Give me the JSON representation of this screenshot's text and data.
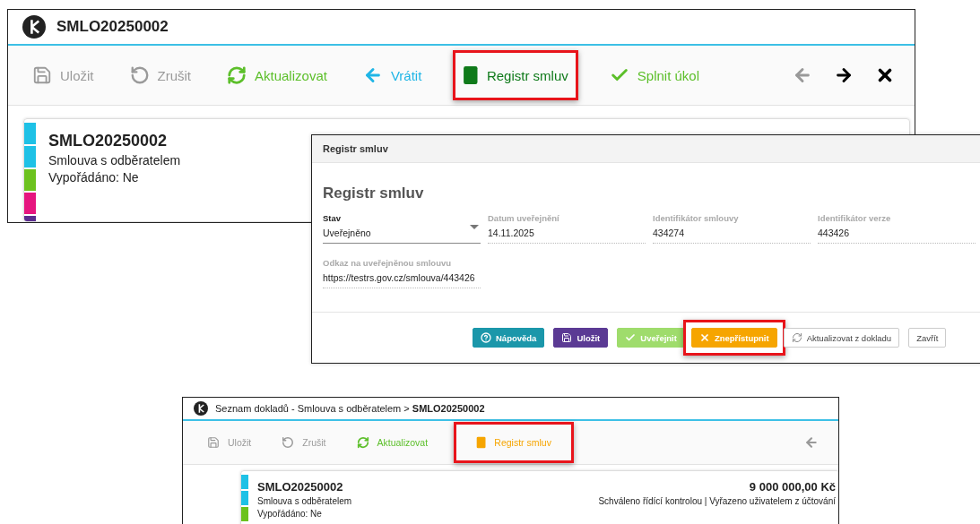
{
  "detail_window": {
    "title": "SMLO20250002",
    "toolbar": [
      {
        "kind": "save",
        "label": "Uložit",
        "color": "#9a9a9a",
        "highlighted": false
      },
      {
        "kind": "cancel",
        "label": "Zrušit",
        "color": "#9a9a9a",
        "highlighted": false
      },
      {
        "kind": "refresh",
        "label": "Aktualizovat",
        "color": "#5cbf2a",
        "highlighted": false
      },
      {
        "kind": "back",
        "label": "Vrátit",
        "color": "#1fb5e6",
        "highlighted": false
      },
      {
        "kind": "register",
        "label": "Registr smluv",
        "color": "#0f7a1a",
        "highlighted": true
      },
      {
        "kind": "complete",
        "label": "Splnit úkol",
        "color": "#5cbf2a",
        "highlighted": false
      }
    ],
    "card": {
      "number": "SMLO20250002",
      "type": "Smlouva s odběratelem",
      "settled": "Vypořádáno: Ne",
      "stripes": [
        {
          "color": "#1ec1e6"
        },
        {
          "color": "#1ec1e6"
        },
        {
          "color": "#6cc21e"
        },
        {
          "color": "#e6157f"
        },
        {
          "color": "#5b2d8e"
        }
      ]
    }
  },
  "dialog": {
    "header": "Registr smluv",
    "title": "Registr smluv",
    "fields": [
      {
        "kind": "select",
        "label": "Stav",
        "value": "Uveřejněno"
      },
      {
        "kind": "text",
        "label": "Datum uveřejnění",
        "value": "14.11.2025"
      },
      {
        "kind": "text",
        "label": "Identifikátor smlouvy",
        "value": "434274"
      },
      {
        "kind": "text",
        "label": "Identifikátor verze",
        "value": "443426"
      },
      {
        "kind": "text",
        "label": "Odkaz na uveřejněnou smlouvu",
        "value": "https://testrs.gov.cz/smlouva/443426"
      }
    ],
    "buttons": [
      {
        "kind": "help",
        "label": "Nápověda",
        "color": "#1b97aa",
        "highlighted": false
      },
      {
        "kind": "save",
        "label": "Uložit",
        "color": "#5b3a94",
        "highlighted": false
      },
      {
        "kind": "publish",
        "label": "Uveřejnit",
        "color": "#9fdc6c",
        "highlighted": false
      },
      {
        "kind": "unpublish",
        "label": "Znepřístupnit",
        "color": "#f6a500",
        "highlighted": true
      },
      {
        "kind": "refresh",
        "label": "Aktualizovat z dokladu",
        "color": "#ffffff",
        "highlighted": false
      },
      {
        "kind": "close",
        "label": "Zavřít",
        "color": "#ffffff",
        "highlighted": false
      }
    ]
  },
  "list_window": {
    "breadcrumb": "Seznam dokladů - Smlouva s odběratelem > **SMLO20250002**",
    "toolbar": [
      {
        "kind": "save",
        "label": "Uložit",
        "color": "#9a9a9a",
        "highlighted": false
      },
      {
        "kind": "cancel",
        "label": "Zrušit",
        "color": "#9a9a9a",
        "highlighted": false
      },
      {
        "kind": "refresh",
        "label": "Aktualizovat",
        "color": "#5cbf2a",
        "highlighted": false
      },
      {
        "kind": "register",
        "label": "Registr smluv",
        "color": "#f6a500",
        "highlighted": true
      }
    ],
    "card": {
      "number": "SMLO20250002",
      "type": "Smlouva s odběratelem",
      "settled": "Vypořádáno: Ne",
      "amount": "9 000 000,00 Kč",
      "status": "Schváleno řídící kontrolou | Vyřazeno uživatelem z účtování",
      "stripes": [
        {
          "color": "#1ec1e6"
        },
        {
          "color": "#1ec1e6"
        },
        {
          "color": "#6cc21e"
        }
      ]
    }
  }
}
